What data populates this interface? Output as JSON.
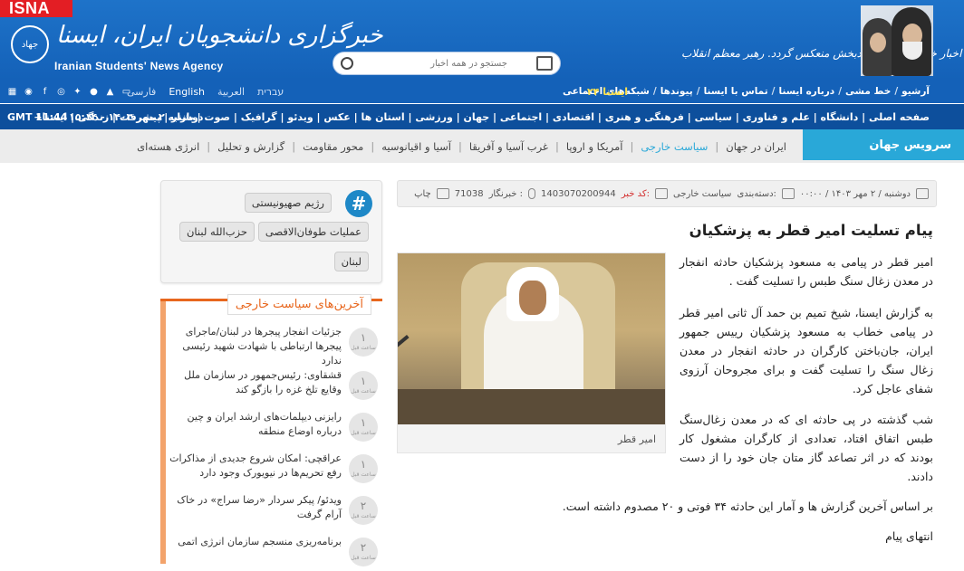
{
  "header": {
    "badge": "ISNA",
    "logo_circle_text": "جهاد",
    "logo_fa": "خبرگزاری دانشجویان ایران، ایسنا",
    "logo_en": "Iranian Students' News Agency",
    "slogan": "اخبار خوب، مفید و امیدبخش منعکس گردد. رهبر معظم انقلاب",
    "search_placeholder": "جستجو در همه اخبار"
  },
  "toprow": {
    "links": [
      "آرشیو",
      "خط مشی",
      "درباره ایسنا",
      "تماس با ایسنا",
      "پیوندها",
      "شبکه‌های اجتماعی"
    ],
    "isna24": "ایسنا ۲۴",
    "langs": [
      "فارسی",
      "English",
      "العربية",
      "עברית"
    ],
    "icons": [
      "rss-icon",
      "android-icon",
      "apple-icon",
      "twitter-icon",
      "instagram-icon",
      "facebook-icon",
      "telegram-icon",
      "grid-icon"
    ]
  },
  "menubar": {
    "gmt": "GMT 11:44",
    "date": "دوشنبه ۲ مهر ۱۴۰۳ - ۱۵:۱۴",
    "categories": "صفحه اصلی | دانشگاه | علم و فناوری | سیاسی | فرهنگی و هنری | اقتصادی | اجتماعی | جهان | ورزشی | استان ها | عکس | ویدئو | گرافیک | صوت | بازار | پیشرفت | زندگی | ایسنا+"
  },
  "subnav": {
    "title": "سرویس جهان",
    "items": [
      "ایران در جهان",
      "سیاست خارجی",
      "آمریکا و اروپا",
      "غرب آسیا و آفریقا",
      "آسیا و اقیانوسیه",
      "محور مقاومت",
      "گزارش و تحلیل",
      "انرژی هسته‌ای"
    ],
    "active_index": 1
  },
  "meta": {
    "date": "دوشنبه / ۲ مهر ۱۴۰۳ / ۰۰:۰۰",
    "category_label": "دسته‌بندی:",
    "category": "سیاست خارجی",
    "code_label": "کد خبر:",
    "code": "1403070200944",
    "reporter_label": "خبرنگار :",
    "reporter": "71038",
    "print": "چاپ"
  },
  "article": {
    "title": "پیام تسلیت امیر قطر به پزشکیان",
    "lead": "امیر قطر در پیامی به مسعود پزشکیان حادثه انفجار در معدن زغال سنگ طبس را تسلیت گفت .",
    "p1": "به گزارش ایسنا، شیخ تمیم بن حمد آل ثانی امیر قطر در پیامی خطاب  به مسعود پزشکیان رییس جمهور ایران، جان‌باختن کارگران در حادثه انفجار در معدن زغال سنگ را تسلیت گفت و برای مجروحان آرزوی شفای عاجل کرد.",
    "p2": "شب گذشته در پی حادثه ای که در معدن زغال‌سنگ طبس اتفاق افتاد، تعدادی  از کارگران مشغول کار بودند که در اثر تصاعد گاز متان جان خود را از دست دادند.",
    "p3": "بر اساس آخرین گزارش ها و آمار این حادثه ۳۴ فوتی و ۲۰ مصدوم داشته است.",
    "p4": "انتهای پیام",
    "photo_caption": "امیر قطر"
  },
  "tags": [
    "رژیم صهیونیستی",
    "عملیات طوفان‌الاقصی",
    "حزب‌الله لبنان",
    "لبنان"
  ],
  "latest": {
    "title": "آخرین‌های سیاست خارجی",
    "items": [
      {
        "text": "جزئیات انفجار پیجرها در لبنان/ماجرای پیجرها ارتباطی با شهادت شهید رئیسی ندارد",
        "num": "۱",
        "unit": "ساعت قبل"
      },
      {
        "text": "قشقاوی: رئیس‌جمهور در سازمان ملل وقایع تلخ غزه را بازگو کند",
        "num": "۱",
        "unit": "ساعت قبل"
      },
      {
        "text": "رایزنی دیپلمات‌های ارشد ایران و چین درباره اوضاع منطقه",
        "num": "۱",
        "unit": "ساعت قبل"
      },
      {
        "text": "عراقچی: امکان شروع جدیدی از مذاکرات رفع تحریم‌ها در نیویورک وجود دارد",
        "num": "۱",
        "unit": "ساعت قبل"
      },
      {
        "text": "ویدئو/ پیکر سردار «رضا سراج» در خاک آرام گرفت",
        "num": "۲",
        "unit": "ساعت قبل"
      },
      {
        "text": "برنامه‌ریزی منسجم سازمان انرژی اتمی",
        "num": "۲",
        "unit": "ساعت قبل"
      }
    ]
  }
}
